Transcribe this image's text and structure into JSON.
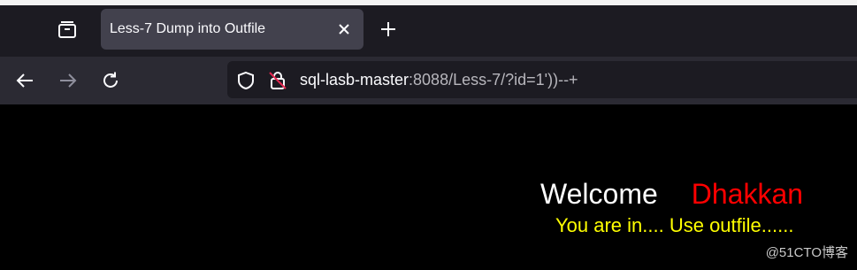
{
  "browser": {
    "tab": {
      "title": "Less-7 Dump into Outfile",
      "close_icon": "close-icon"
    },
    "toolbar": {
      "url_host": "sql-lasb-master",
      "url_rest": ":8088/Less-7/?id=1'))--+"
    },
    "icons": {
      "tab_list": "tab-list-icon",
      "new_tab": "plus-icon",
      "back": "back-arrow-icon",
      "forward": "forward-arrow-icon",
      "reload": "reload-icon",
      "shield": "shield-icon",
      "insecure_lock": "insecure-lock-icon"
    },
    "colors": {
      "tab_bar_bg": "#1c1b22",
      "active_tab_bg": "#42414d",
      "nav_bar_bg": "#2b2a33",
      "url_bar_bg": "#1c1b22",
      "insecure_red": "#e22850"
    }
  },
  "page": {
    "welcome_word": "Welcome",
    "welcome_name": "Dhakkan",
    "status_message": "You are in.... Use outfile......",
    "background": "#000000",
    "colors": {
      "welcome": "#ffffff",
      "name": "#ff0000",
      "status": "#ffff00"
    }
  },
  "watermark": "@51CTO博客"
}
